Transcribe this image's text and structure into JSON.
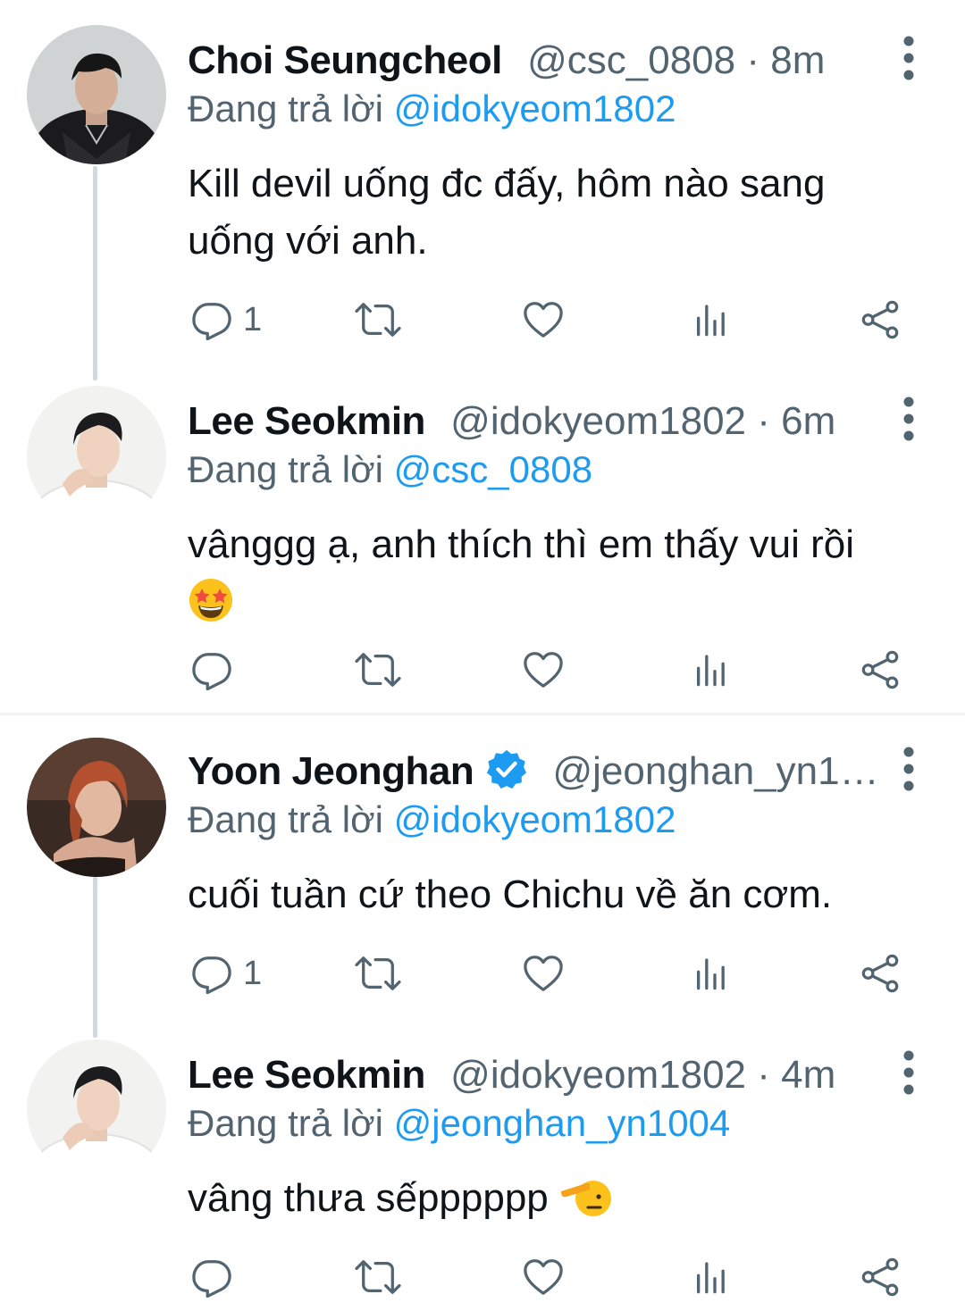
{
  "tweets": [
    {
      "name": "Choi Seungcheol",
      "handle": "@csc_0808",
      "sep": "·",
      "time": "8m",
      "reply_prefix": "Đang trả lời",
      "reply_to": "@idokyeom1802",
      "text_line1": "Kill devil uống đc đấy, hôm nào sang",
      "text_line2": "uống với anh.",
      "reply_count": "1"
    },
    {
      "name": "Lee Seokmin",
      "handle": "@idokyeom1802",
      "sep": "·",
      "time": "6m",
      "reply_prefix": "Đang trả lời",
      "reply_to": "@csc_0808",
      "text_line1": "vânggg ạ, anh thích thì em thấy vui rồi",
      "emoji": "star-struck-emoji"
    },
    {
      "name": "Yoon Jeonghan",
      "verified": true,
      "handle": "@jeonghan_yn1…",
      "reply_prefix": "Đang trả lời",
      "reply_to": "@idokyeom1802",
      "text_line1": "cuối tuần cứ theo Chichu về ăn cơm.",
      "reply_count": "1"
    },
    {
      "name": "Lee Seokmin",
      "handle": "@idokyeom1802",
      "sep": "·",
      "time": "4m",
      "reply_prefix": "Đang trả lời",
      "reply_to": "@jeonghan_yn1004",
      "text_line1": "vâng thưa sếpppppp",
      "emoji": "saluting-face-emoji"
    }
  ],
  "colors": {
    "text": "#0f1419",
    "secondary": "#536471",
    "link": "#1d9bf0",
    "thread_line": "#cfd9de",
    "divider": "#eff3f4"
  },
  "icons": [
    "reply-icon",
    "retweet-icon",
    "like-icon",
    "views-icon",
    "share-icon",
    "more-options-icon",
    "verified-badge-icon"
  ]
}
